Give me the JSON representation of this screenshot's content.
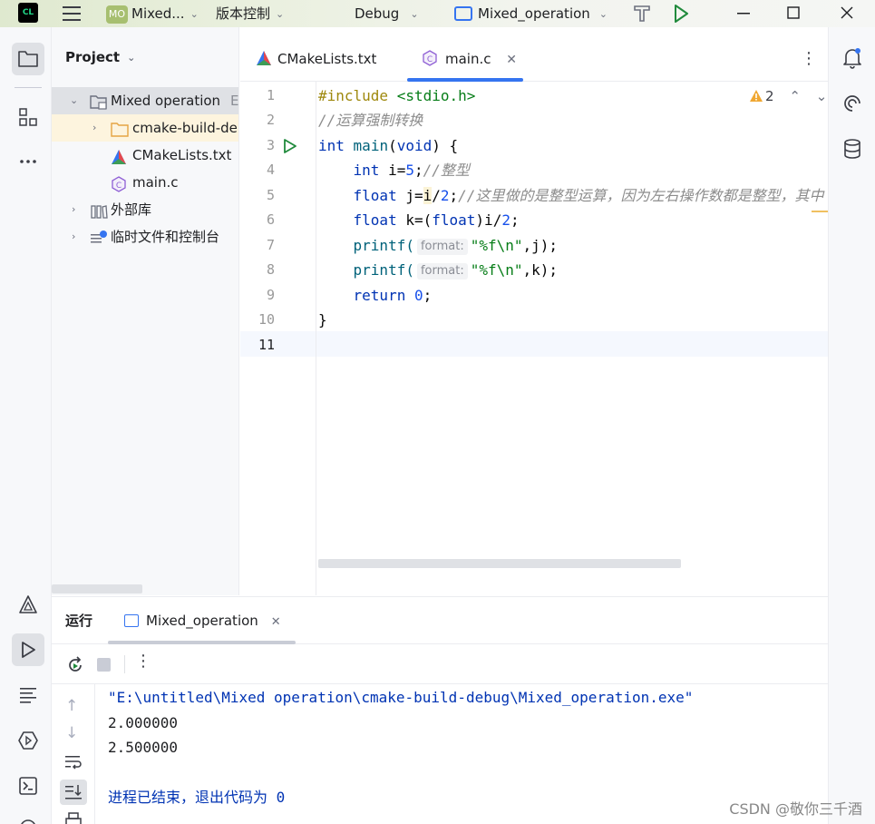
{
  "titlebar": {
    "logo_text": "CL",
    "project_badge": "MO",
    "project_name": "Mixed...",
    "vcs_label": "版本控制",
    "build_config": "Debug",
    "run_config": "Mixed_operation"
  },
  "project_panel": {
    "title": "Project",
    "tree": [
      {
        "label": "Mixed operation",
        "suffix": "E"
      },
      {
        "label": "cmake-build-del"
      },
      {
        "label": "CMakeLists.txt"
      },
      {
        "label": "main.c"
      },
      {
        "label": "外部库"
      },
      {
        "label": "临时文件和控制台"
      }
    ]
  },
  "editor": {
    "tabs": [
      {
        "label": "CMakeLists.txt"
      },
      {
        "label": "main.c"
      }
    ],
    "warning_count": "2",
    "line_numbers": [
      "1",
      "2",
      "3",
      "4",
      "5",
      "6",
      "7",
      "8",
      "9",
      "10",
      "11"
    ],
    "code": {
      "l1_directive": "#include",
      "l1_header": "<stdio.h>",
      "l2_comment": "//运算强制转换",
      "l3_kw": "int",
      "l3_fn": "main",
      "l3_kw2": "void",
      "l4_kw": "int",
      "l4_var": "i=",
      "l4_num": "5",
      "l4_semi": ";",
      "l4_comment": "//整型",
      "l5_kw": "float",
      "l5_var": "j=",
      "l5_i": "i",
      "l5_div": "/",
      "l5_num": "2",
      "l5_semi": ";",
      "l5_comment": "//这里做的是整型运算，因为左右操作数都是整型，其中",
      "l6_kw": "float",
      "l6_a": "k=(",
      "l6_cast": "float",
      "l6_b": ")i/",
      "l6_num": "2",
      "l6_semi": ";",
      "l7_fn": "printf(",
      "l7_hint": "format:",
      "l7_str": "\"%f\\n\"",
      "l7_rest": ",j);",
      "l8_fn": "printf(",
      "l8_hint": "format:",
      "l8_str": "\"%f\\n\"",
      "l8_rest": ",k);",
      "l9_kw": "return",
      "l9_num": "0",
      "l9_semi": ";",
      "l10_brace": "}"
    }
  },
  "run_panel": {
    "title": "运行",
    "tab_label": "Mixed_operation",
    "output": [
      "\"E:\\untitled\\Mixed operation\\cmake-build-debug\\Mixed_operation.exe\"",
      "2.000000",
      "2.500000",
      "",
      "进程已结束，退出代码为 0"
    ]
  },
  "watermark": "CSDN @敬你三千酒",
  "colors": {
    "accent": "#3574f0",
    "keyword": "#0033b3",
    "number": "#1750eb",
    "string": "#067d17",
    "comment": "#8c8c8c",
    "run_green": "#208a3c"
  }
}
